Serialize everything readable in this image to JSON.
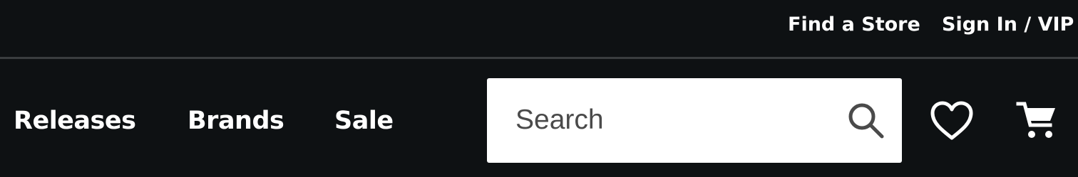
{
  "utility": {
    "find_store": "Find a Store",
    "sign_in": "Sign In / VIP"
  },
  "nav": {
    "items": [
      {
        "label": "Releases"
      },
      {
        "label": "Brands"
      },
      {
        "label": "Sale"
      }
    ]
  },
  "search": {
    "placeholder": "Search",
    "icon": "search-icon"
  },
  "actions": {
    "favorites_icon": "heart-icon",
    "cart_icon": "cart-icon"
  },
  "colors": {
    "background": "#0e1113",
    "divider": "#3a3d3f",
    "text": "#ffffff",
    "search_bg": "#ffffff",
    "search_text": "#4a4a4a"
  }
}
